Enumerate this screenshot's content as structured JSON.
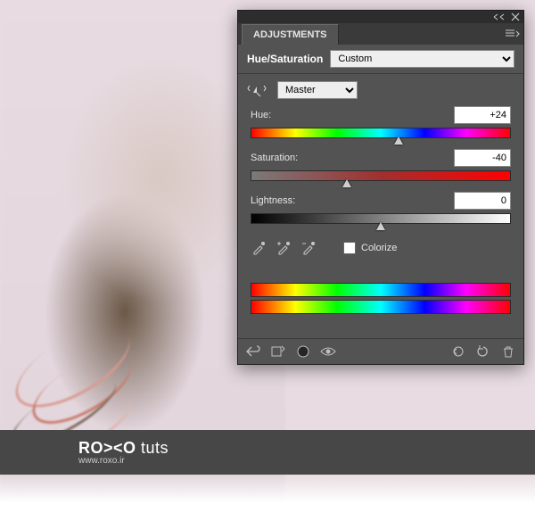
{
  "watermark": {
    "brand_bold": "RO><O",
    "brand_light": " tuts",
    "url": "www.roxo.ir"
  },
  "panel": {
    "tab": "ADJUSTMENTS",
    "adjustment_name": "Hue/Saturation",
    "preset": "Custom",
    "channel": "Master",
    "sliders": {
      "hue": {
        "label": "Hue:",
        "value": "+24",
        "thumb_pct": 57
      },
      "saturation": {
        "label": "Saturation:",
        "value": "-40",
        "thumb_pct": 37
      },
      "lightness": {
        "label": "Lightness:",
        "value": "0",
        "thumb_pct": 50
      }
    },
    "colorize_label": "Colorize",
    "colorize_checked": false
  }
}
